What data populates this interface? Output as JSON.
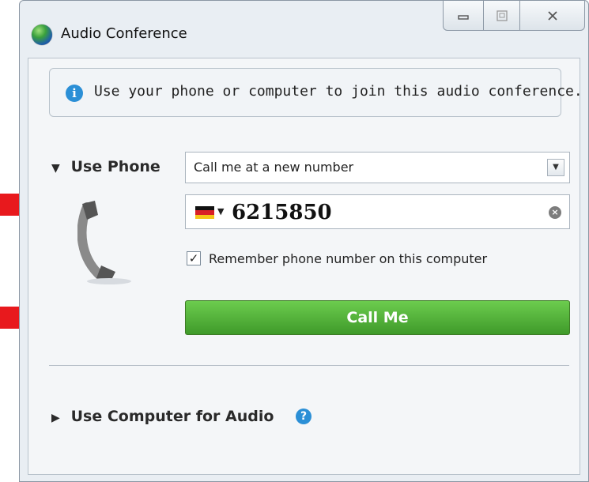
{
  "window": {
    "title": "Audio Conference"
  },
  "info": {
    "text": "Use your phone or computer to join this audio conference."
  },
  "phone_section": {
    "label": "Use Phone",
    "call_option": "Call me at a new number",
    "phone_number": "6215850",
    "country": "Germany",
    "remember_label": "Remember phone number on this computer",
    "remember_checked": true,
    "call_button_label": "Call Me"
  },
  "computer_section": {
    "label": "Use Computer for Audio"
  },
  "icons": {
    "info": "info-icon",
    "help": "help-icon",
    "handset": "phone-handset-icon",
    "clear": "clear-icon",
    "dropdown": "chevron-down-icon"
  },
  "colors": {
    "call_button": "#4caf3a",
    "annotation_arrow": "#e8191d",
    "info_icon": "#2b8fd6"
  }
}
